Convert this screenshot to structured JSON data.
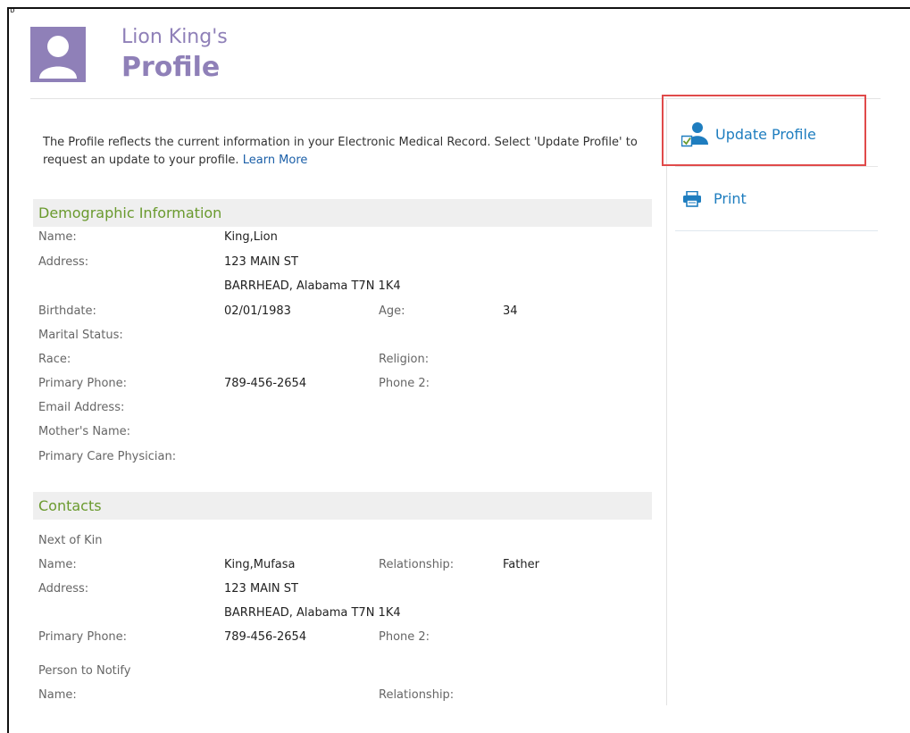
{
  "header": {
    "name_possessive": "Lion King's",
    "page_title": "Profile"
  },
  "intro": {
    "text": "The Profile reflects the current information in your Electronic Medical Record. Select 'Update Profile' to request an update to your profile.",
    "learn_more_label": "Learn More"
  },
  "sidebar": {
    "update_profile_label": "Update Profile",
    "print_label": "Print"
  },
  "demographics": {
    "heading": "Demographic Information",
    "name_label": "Name:",
    "name_value": "King,Lion",
    "address_label": "Address:",
    "address_line1": "123 MAIN ST",
    "address_line2": "BARRHEAD, Alabama T7N 1K4",
    "birthdate_label": "Birthdate:",
    "birthdate_value": "02/01/1983",
    "age_label": "Age:",
    "age_value": "34",
    "marital_label": "Marital Status:",
    "race_label": "Race:",
    "religion_label": "Religion:",
    "primary_phone_label": "Primary Phone:",
    "primary_phone_value": "789-456-2654",
    "phone2_label": "Phone 2:",
    "email_label": "Email Address:",
    "mother_label": "Mother's Name:",
    "pcp_label": "Primary Care Physician:"
  },
  "contacts": {
    "heading": "Contacts",
    "next_of_kin_heading": "Next of Kin",
    "kin_name_label": "Name:",
    "kin_name_value": "King,Mufasa",
    "kin_relationship_label": "Relationship:",
    "kin_relationship_value": "Father",
    "kin_address_label": "Address:",
    "kin_address_line1": "123 MAIN ST",
    "kin_address_line2": "BARRHEAD, Alabama T7N 1K4",
    "kin_primary_phone_label": "Primary Phone:",
    "kin_primary_phone_value": "789-456-2654",
    "kin_phone2_label": "Phone 2:",
    "person_to_notify_heading": "Person to Notify",
    "notify_name_label": "Name:",
    "notify_relationship_label": "Relationship:"
  },
  "colors": {
    "brand_purple": "#8f80b8",
    "section_green": "#6a9a2e",
    "link_blue": "#1e7dbf",
    "highlight_red": "#e04a4a"
  }
}
